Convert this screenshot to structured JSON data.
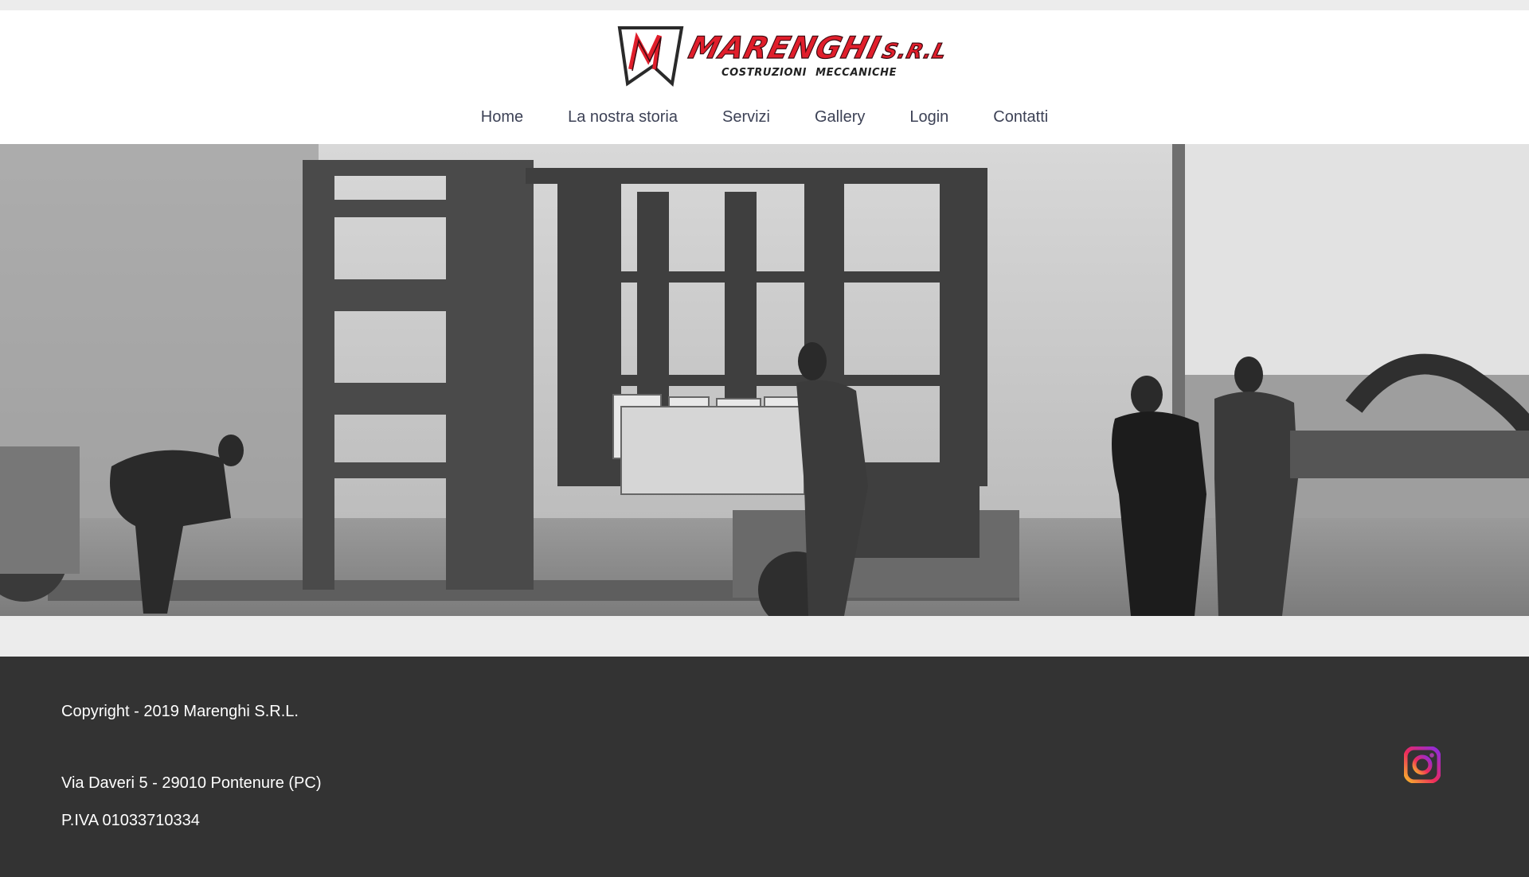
{
  "header": {
    "logo": {
      "wordmark": "MARENGHI",
      "suffix": "S.R.L",
      "tagline": "COSTRUZIONI MECCANICHE",
      "colors": {
        "primary": "#e01e2b",
        "dark": "#3a0a10"
      }
    },
    "nav": [
      {
        "label": "Home"
      },
      {
        "label": "La nostra storia"
      },
      {
        "label": "Servizi"
      },
      {
        "label": "Gallery"
      },
      {
        "label": "Login"
      },
      {
        "label": "Contatti"
      }
    ]
  },
  "hero": {
    "image": "black-and-white photo of workers loading steel frame structures onto a trailer in a workshop"
  },
  "footer": {
    "copyright": "Copyright - 2019 Marenghi S.R.L.",
    "address": "Via Daveri 5 - 29010 Pontenure (PC)",
    "vat": "P.IVA 01033710334",
    "social_icon": "instagram-icon"
  },
  "colors": {
    "nav_text": "#3d4256",
    "footer_bg": "#333333",
    "page_bg": "#ececec"
  }
}
